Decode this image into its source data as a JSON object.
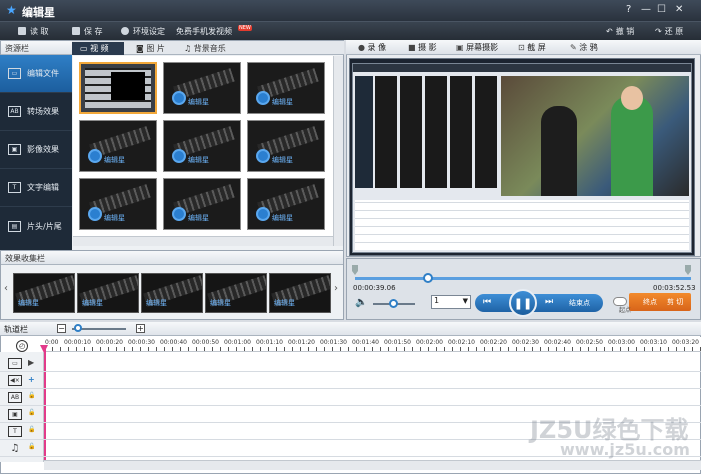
{
  "app": {
    "title": "编辑星",
    "brand_color": "#2f7fc6"
  },
  "window_buttons": [
    "?",
    "—",
    "☐",
    "✕"
  ],
  "toolbar": {
    "read": "读 取",
    "save": "保 存",
    "settings": "环境设定",
    "promo": "免费手机发视频",
    "new_badge": "NEW",
    "undo": "撤 销",
    "redo": "还 原"
  },
  "resource_panel": {
    "title": "资源栏",
    "tabs": [
      "视 频",
      "图 片",
      "背景音乐"
    ]
  },
  "side_nav": [
    {
      "label": "编辑文件",
      "icon": "film-icon",
      "glyph": "▭"
    },
    {
      "label": "转场效果",
      "icon": "transition-icon",
      "glyph": "AB"
    },
    {
      "label": "影像效果",
      "icon": "image-effect-icon",
      "glyph": "▣"
    },
    {
      "label": "文字编辑",
      "icon": "text-icon",
      "glyph": "T"
    },
    {
      "label": "片头/片尾",
      "icon": "intro-outro-icon",
      "glyph": "▤"
    }
  ],
  "thumb_label": "编辑星",
  "fx_panel": {
    "title": "效果收集栏"
  },
  "right_tabs": [
    "录 像",
    "摄 影",
    "屏幕摄影",
    "截 屏",
    "涂 鸦"
  ],
  "player": {
    "time_current": "00:00:39.06",
    "time_total": "00:03:52.53",
    "end_point": "结束点",
    "btn_a": "起点",
    "btn_b": "终点",
    "btn_c": "剪 切",
    "speed_value": "1"
  },
  "timeline": {
    "title": "轨道栏",
    "ticks": [
      "0:00",
      "00:00:10",
      "00:00:20",
      "00:00:30",
      "00:00:40",
      "00:00:50",
      "00:01:00",
      "00:01:10",
      "00:01:20",
      "00:01:30",
      "00:01:40",
      "00:01:50",
      "00:02:00",
      "00:02:10",
      "00:02:20",
      "00:02:30",
      "00:02:40",
      "00:02:50",
      "00:03:00",
      "00:03:10",
      "00:03:20"
    ],
    "tracks": [
      {
        "icon": "video-track-icon",
        "glyph": "▭",
        "ctl": "▶"
      },
      {
        "icon": "audio-track-icon",
        "glyph": "◀×",
        "ctl": "+"
      },
      {
        "icon": "transition-track-icon",
        "glyph": "AB",
        "ctl": "🔓"
      },
      {
        "icon": "effect-track-icon",
        "glyph": "▣",
        "ctl": "🔓"
      },
      {
        "icon": "text-track-icon",
        "glyph": "T",
        "ctl": "🔓"
      },
      {
        "icon": "music-track-icon",
        "glyph": "♫",
        "ctl": "🔓"
      }
    ]
  },
  "watermark": {
    "line1": "JZ5U绿色下载",
    "line2": "www.jz5u.com"
  }
}
